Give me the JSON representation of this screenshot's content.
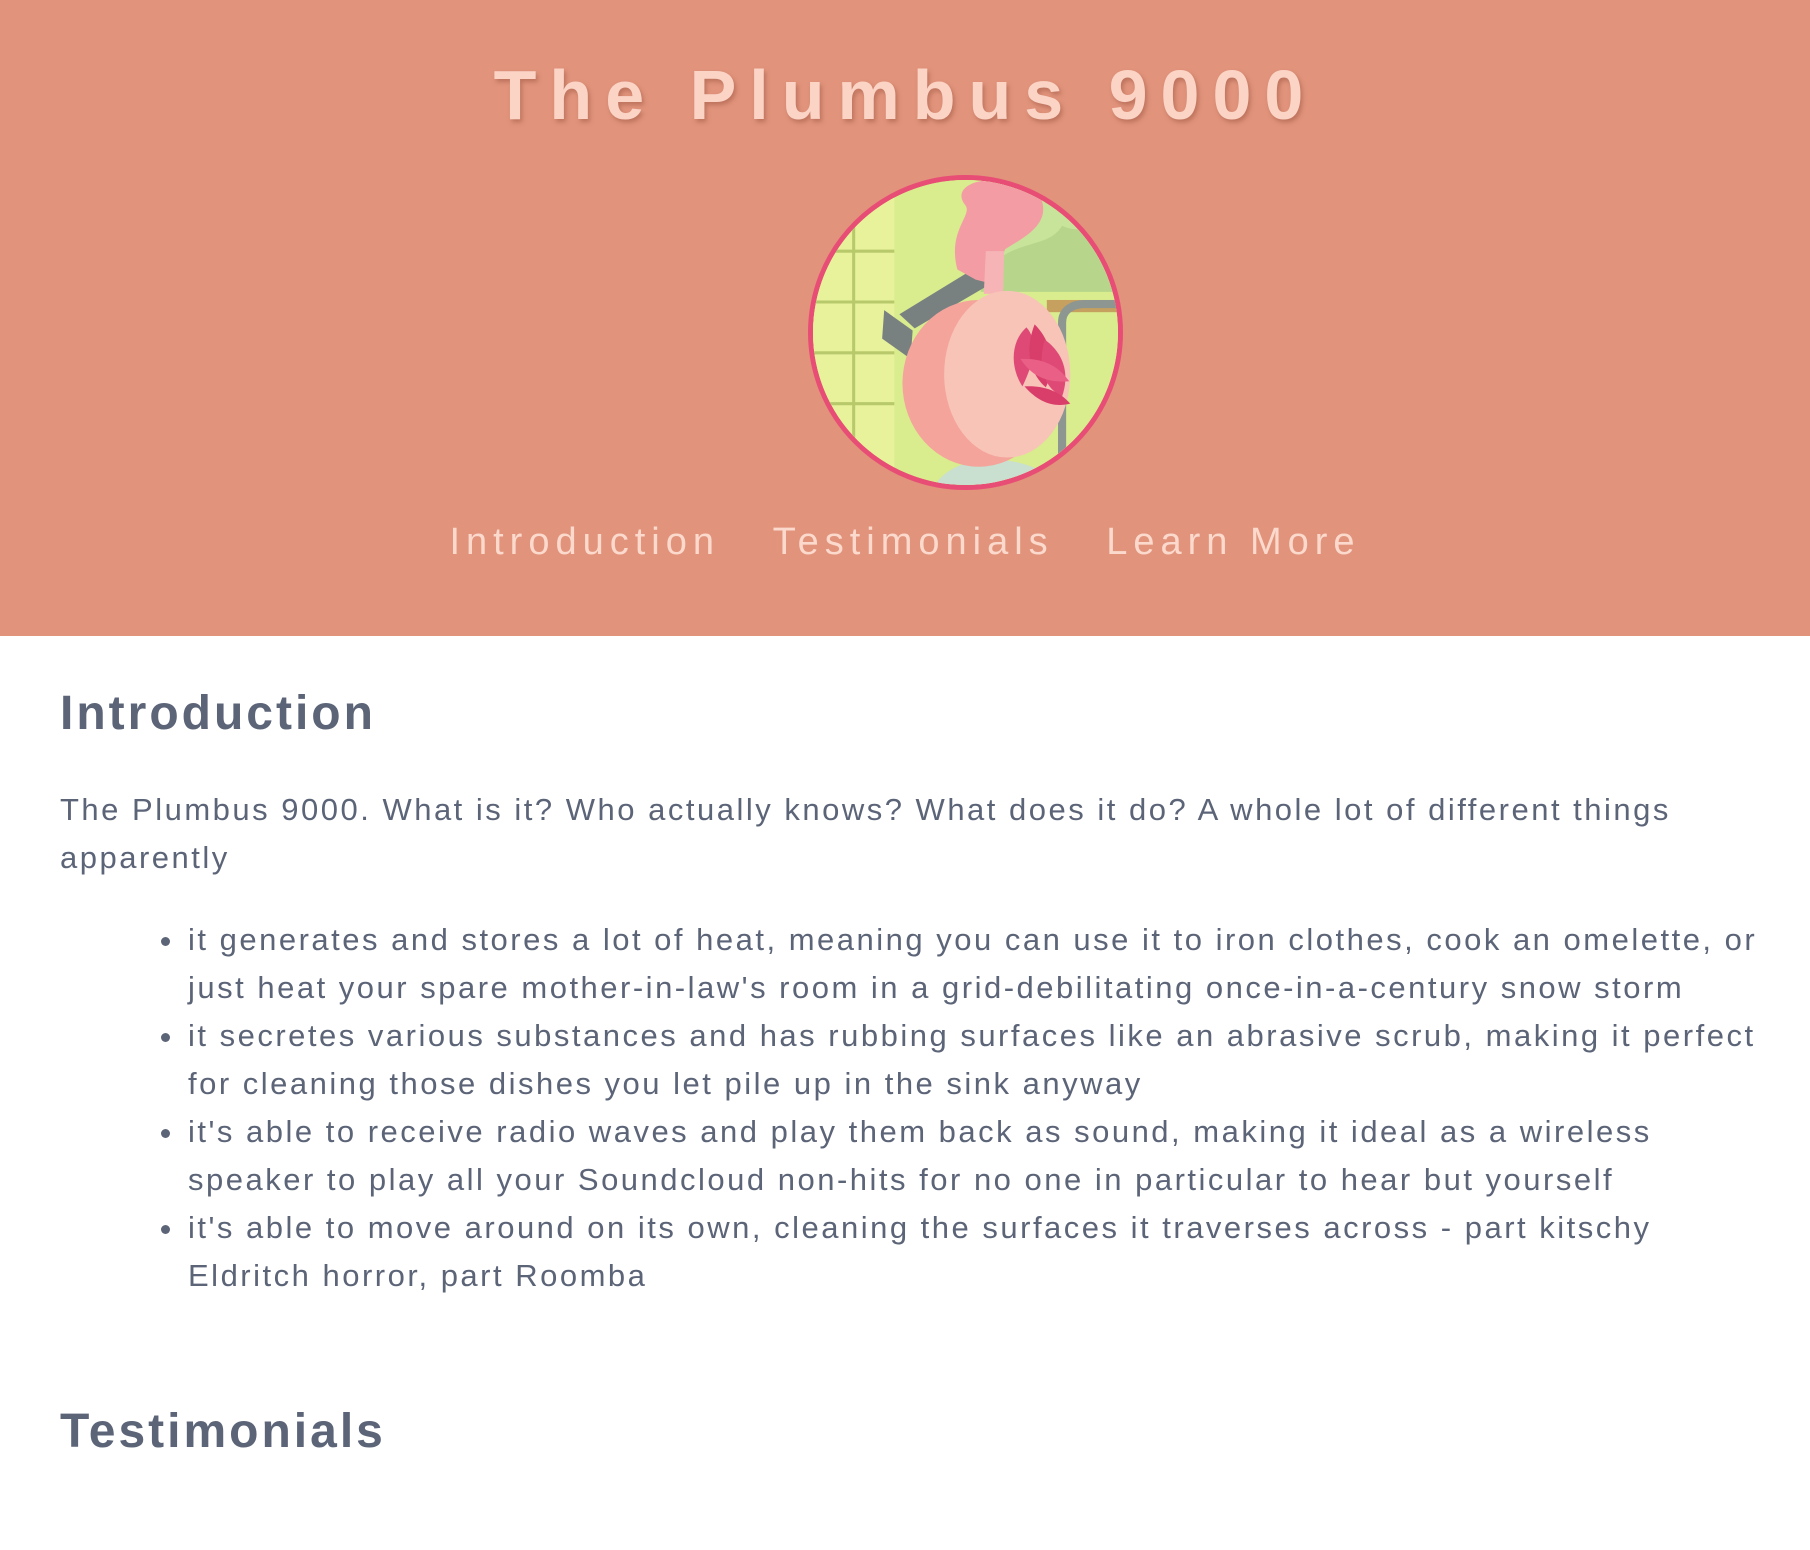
{
  "header": {
    "title": "The Plumbus 9000",
    "image_icon": "plumbus-image",
    "accent_color": "#e1937b",
    "image_border_color": "#e84d76"
  },
  "nav": {
    "items": [
      {
        "label": "Introduction"
      },
      {
        "label": "Testimonials"
      },
      {
        "label": "Learn More"
      }
    ]
  },
  "introduction": {
    "heading": "Introduction",
    "paragraph": "The Plumbus 9000. What is it? Who actually knows? What does it do? A whole lot of different things apparently",
    "features": [
      "it generates and stores a lot of heat, meaning you can use it to iron clothes, cook an omelette, or just heat your spare mother-in-law's room in a grid-debilitating once-in-a-century snow storm",
      "it secretes various substances and has rubbing surfaces like an abrasive scrub, making it perfect for cleaning those dishes you let pile up in the sink anyway",
      "it's able to receive radio waves and play them back as sound, making it ideal as a wireless speaker to play all your Soundcloud non-hits for no one in particular to hear but yourself",
      "it's able to move around on its own, cleaning the surfaces it traverses across - part kitschy Eldritch horror, part Roomba"
    ]
  },
  "testimonials": {
    "heading": "Testimonials"
  }
}
